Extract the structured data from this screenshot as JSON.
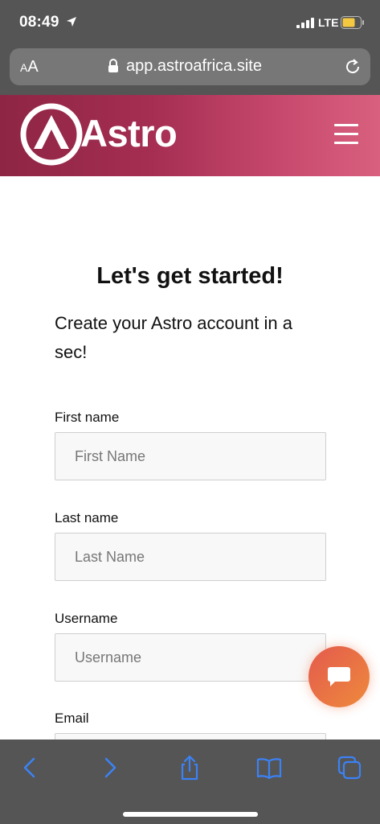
{
  "status_bar": {
    "time": "08:49",
    "network": "LTE",
    "icons": [
      "location-arrow-icon",
      "signal-bars-icon",
      "battery-icon"
    ]
  },
  "browser": {
    "text_size_label_small": "A",
    "text_size_label_large": "A",
    "url": "app.astroafrica.site",
    "toolbar_icons": [
      "back-icon",
      "forward-icon",
      "share-icon",
      "bookmarks-icon",
      "tabs-icon"
    ]
  },
  "header": {
    "brand": "Astro",
    "menu_icon": "hamburger-menu-icon"
  },
  "form": {
    "title": "Let's get started!",
    "subtitle": "Create your Astro account in a sec!",
    "fields": [
      {
        "label": "First name",
        "placeholder": "First Name",
        "value": ""
      },
      {
        "label": "Last name",
        "placeholder": "Last Name",
        "value": ""
      },
      {
        "label": "Username",
        "placeholder": "Username",
        "value": ""
      },
      {
        "label": "Email",
        "placeholder": "",
        "value": ""
      }
    ]
  },
  "chat": {
    "icon": "chat-bubble-icon"
  },
  "colors": {
    "header_gradient_start": "#8e2545",
    "header_gradient_end": "#d9607f",
    "chat_gradient_start": "#e45a4e",
    "chat_gradient_end": "#ee8a3c",
    "browser_chrome": "#555555",
    "toolbar_icon": "#3b82f6"
  }
}
